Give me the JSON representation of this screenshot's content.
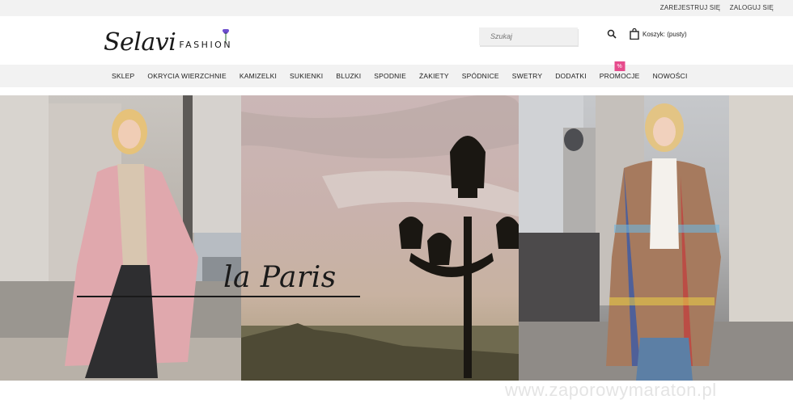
{
  "topbar": {
    "register": "ZAREJESTRUJ SIĘ",
    "login": "ZALOGUJ SIĘ"
  },
  "logo": {
    "script": "Selavi",
    "word": "FASHION"
  },
  "search": {
    "placeholder": "Szukaj"
  },
  "cart": {
    "label": "Koszyk:",
    "status": "(pusty)"
  },
  "nav": {
    "items": [
      "SKLEP",
      "OKRYCIA WIERZCHNIE",
      "KAMIZELKI",
      "SUKIENKI",
      "BLUZKI",
      "SPODNIE",
      "ŻAKIETY",
      "SPÓDNICE",
      "SWETRY",
      "DODATKI",
      "PROMOCJE",
      "NOWOŚCI"
    ],
    "promo_badge": "%"
  },
  "hero": {
    "title": "la Paris"
  },
  "watermark": "www.zaporowymaraton.pl",
  "colors": {
    "topbar": "#f2f2f2",
    "accent_promo": "#e64b8c",
    "text": "#222222"
  }
}
